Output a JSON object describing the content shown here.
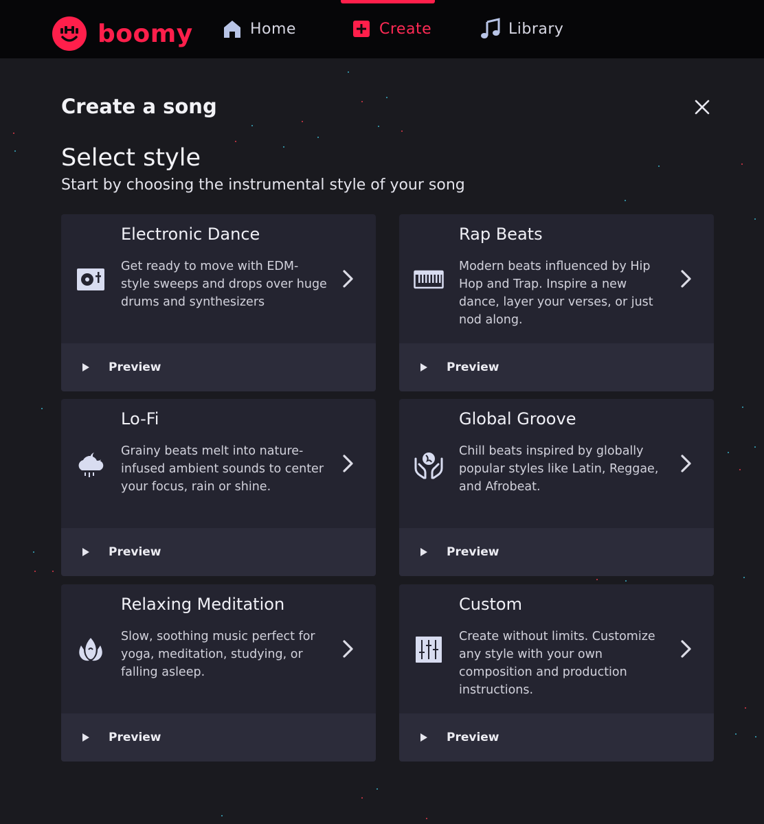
{
  "brand": {
    "name": "boomy",
    "color": "#ff1f4b"
  },
  "nav": {
    "home": "Home",
    "create": "Create",
    "library": "Library"
  },
  "page": {
    "title": "Create a song",
    "section_title": "Select style",
    "section_subtitle": "Start by choosing the instrumental style of your song"
  },
  "styles": [
    {
      "title": "Electronic Dance",
      "description": "Get ready to move with EDM-style sweeps and drops over huge drums and synthesizers",
      "icon": "turntable-icon",
      "preview": "Preview"
    },
    {
      "title": "Rap Beats",
      "description": "Modern beats influenced by Hip Hop and Trap. Inspire a new dance, layer your verses, or just nod along.",
      "icon": "keyboard-icon",
      "preview": "Preview"
    },
    {
      "title": "Lo-Fi",
      "description": "Grainy beats melt into nature-infused ambient sounds to center your focus, rain or shine.",
      "icon": "rain-cloud-moon-icon",
      "preview": "Preview"
    },
    {
      "title": "Global Groove",
      "description": "Chill beats inspired by globally popular styles like Latin, Reggae, and Afrobeat.",
      "icon": "hands-globe-icon",
      "preview": "Preview"
    },
    {
      "title": "Relaxing Meditation",
      "description": "Slow, soothing music perfect for yoga, meditation, studying, or falling asleep.",
      "icon": "lotus-icon",
      "preview": "Preview"
    },
    {
      "title": "Custom",
      "description": "Create without limits. Customize any style with your own composition and production instructions.",
      "icon": "mixer-sliders-icon",
      "preview": "Preview"
    }
  ]
}
